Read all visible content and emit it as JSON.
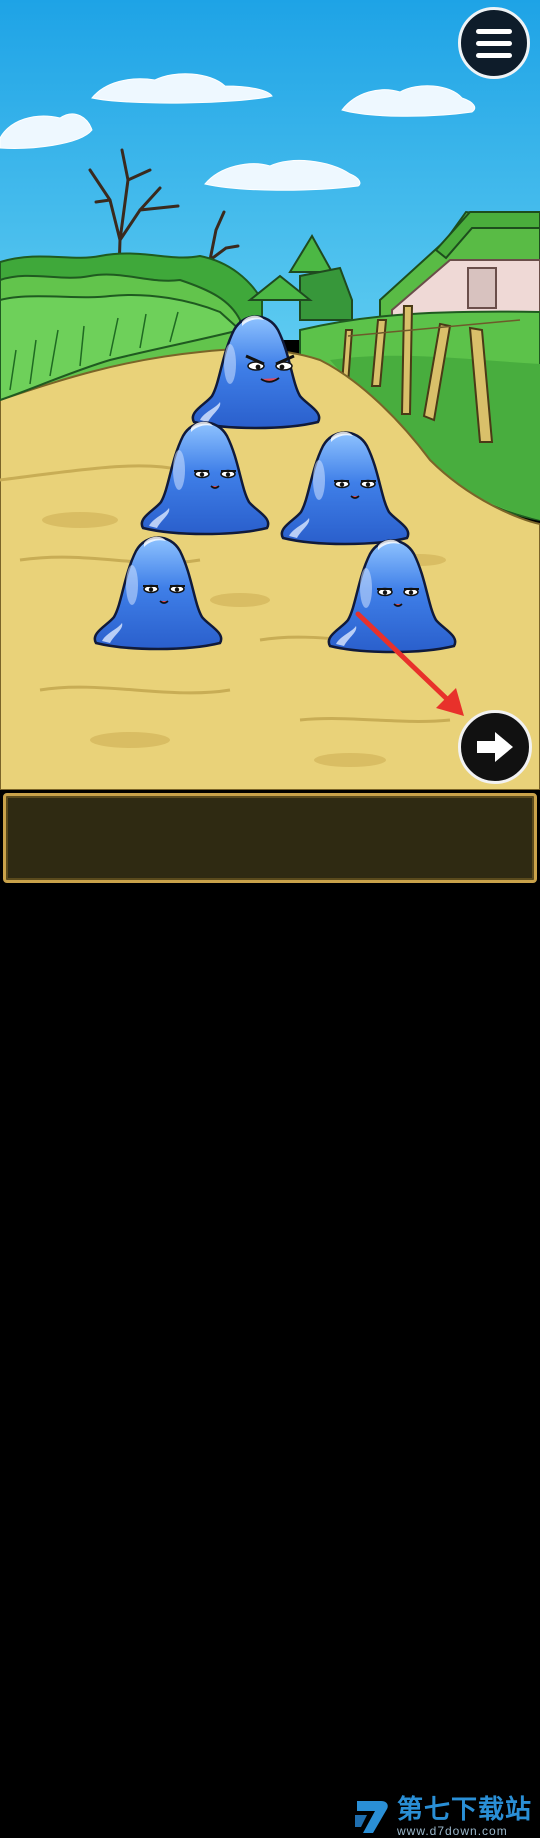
{
  "scene": {
    "description_icons": [
      "menu-icon",
      "arrow-right-icon"
    ],
    "slime_count": 5,
    "hint_arrow_color": "#e8312b",
    "slime_color": "#2f6fe0"
  },
  "menu": {
    "icon": "menu-icon"
  },
  "next": {
    "icon": "arrow-right-icon"
  },
  "message_box": {
    "text": ""
  },
  "watermark": {
    "name": "第七下载站",
    "url": "www.d7down.com"
  }
}
